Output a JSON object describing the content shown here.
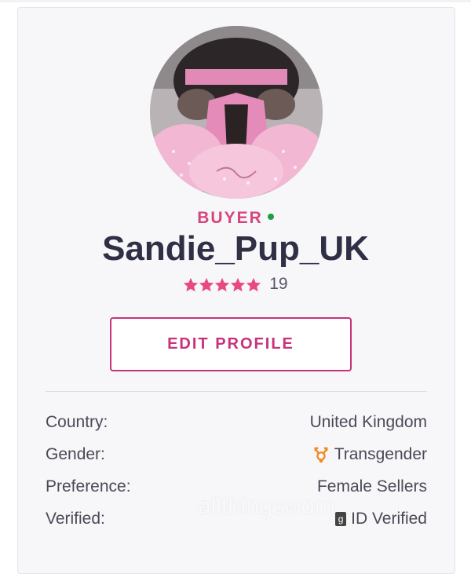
{
  "profile": {
    "role": "BUYER",
    "username": "Sandie_Pup_UK",
    "rating_stars": 5,
    "rating_count": "19",
    "edit_button": "EDIT PROFILE"
  },
  "info": [
    {
      "label": "Country:",
      "value": "United Kingdom"
    },
    {
      "label": "Gender:",
      "value": "Transgender",
      "icon": "transgender-icon"
    },
    {
      "label": "Preference:",
      "value": "Female Sellers"
    },
    {
      "label": "Verified:",
      "value": "ID Verified",
      "icon": "id-badge-icon"
    }
  ],
  "watermark": "allthingsworn",
  "colors": {
    "accent": "#c8327a",
    "role": "#d6457c",
    "star": "#e84a7f",
    "online": "#1e9e44",
    "gender_icon": "#f08a24"
  }
}
